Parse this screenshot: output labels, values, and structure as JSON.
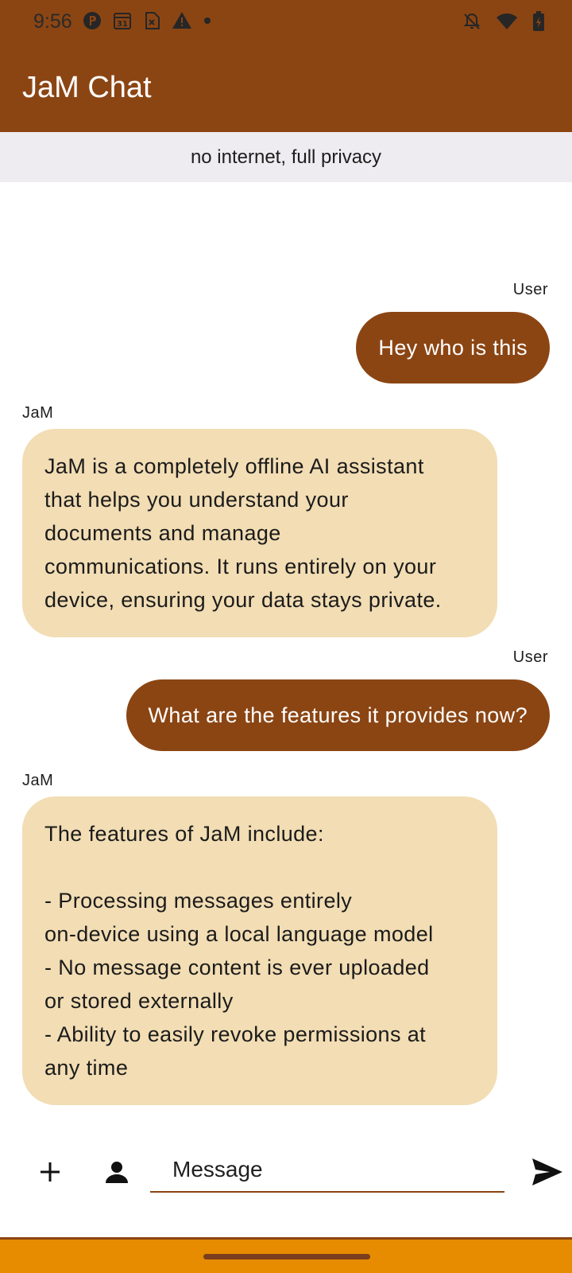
{
  "status_bar": {
    "time": "9:56",
    "left_icons": [
      "data-saver-icon",
      "calendar-31-icon",
      "sim-card-off-icon",
      "warning-icon",
      "more-dot-icon"
    ],
    "right_icons": [
      "notifications-off-icon",
      "wifi-icon",
      "battery-charging-icon"
    ]
  },
  "app_bar": {
    "title": "JaM Chat"
  },
  "banner": {
    "text": "no internet, full privacy"
  },
  "messages": [
    {
      "sender": "User",
      "text": "Hey who is this"
    },
    {
      "sender": "JaM",
      "text": "JaM is a completely offline AI assistant\nthat helps you understand your\ndocuments and manage\ncommunications. It runs entirely on your\ndevice, ensuring your data stays private."
    },
    {
      "sender": "User",
      "text": "What are the features it provides now?"
    },
    {
      "sender": "JaM",
      "text": "The features of JaM include:\n\n- Processing messages entirely\non-device using a local language model\n- No message content is ever uploaded\nor stored externally\n- Ability to easily revoke permissions at\nany time"
    }
  ],
  "composer": {
    "placeholder": "Message",
    "add_icon": "plus-icon",
    "contact_icon": "person-icon",
    "send_icon": "send-icon"
  },
  "colors": {
    "primary": "#8b4513",
    "bot_bubble": "#f2ddb4",
    "banner_bg": "#efecf1",
    "nav_bar": "#e78b00"
  }
}
